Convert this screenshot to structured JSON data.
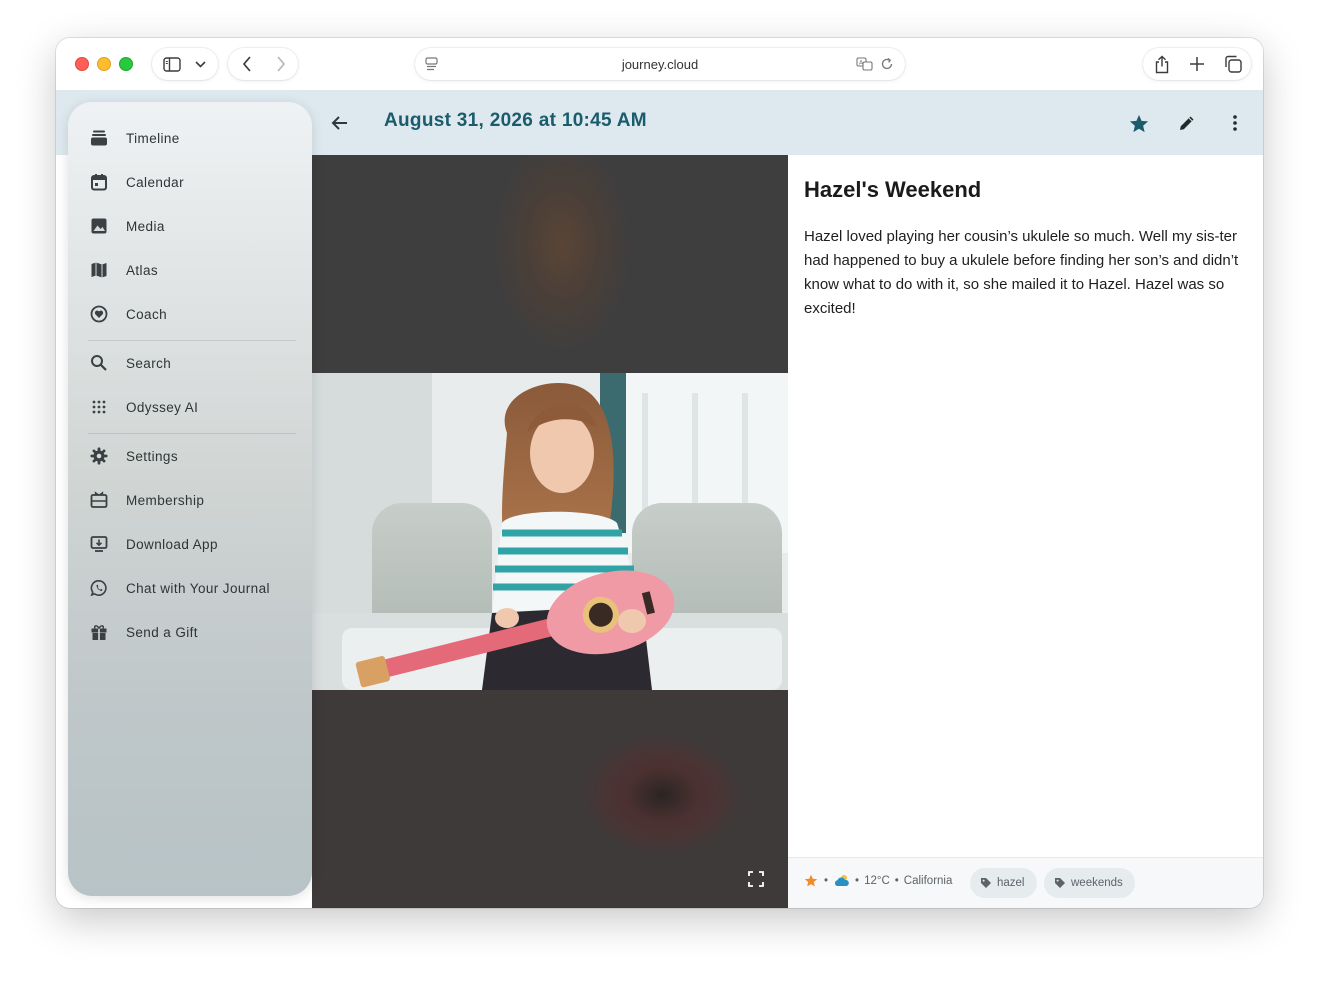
{
  "browser": {
    "url": "journey.cloud"
  },
  "header": {
    "date_title": "August 31, 2026 at 10:45 AM"
  },
  "sidebar": {
    "items": [
      {
        "label": "Timeline",
        "icon": "timeline-icon"
      },
      {
        "label": "Calendar",
        "icon": "calendar-icon"
      },
      {
        "label": "Media",
        "icon": "media-icon"
      },
      {
        "label": "Atlas",
        "icon": "atlas-map-icon"
      },
      {
        "label": "Coach",
        "icon": "coach-heart-icon"
      },
      {
        "label": "Search",
        "icon": "search-icon"
      },
      {
        "label": "Odyssey AI",
        "icon": "odyssey-dots-icon"
      },
      {
        "label": "Settings",
        "icon": "gear-icon"
      },
      {
        "label": "Membership",
        "icon": "membership-icon"
      },
      {
        "label": "Download App",
        "icon": "download-icon"
      },
      {
        "label": "Chat with Your Journal",
        "icon": "whatsapp-chat-icon"
      },
      {
        "label": "Send a Gift",
        "icon": "gift-icon"
      }
    ]
  },
  "entry": {
    "title": "Hazel's Weekend",
    "body": "Hazel loved playing her cousin’s ukulele so much. Well my sis-ter had happened to buy a ukulele before finding her son’s and didn’t know what to do with it, so she mailed it to Hazel. Hazel was so excited!"
  },
  "footer": {
    "temperature": "12°C",
    "location": "California",
    "separator": "•",
    "tags": [
      "hazel",
      "weekends"
    ]
  },
  "colors": {
    "accent": "#1a5c6c",
    "header_bg": "#dde9ee",
    "star": "#f08c2a"
  }
}
